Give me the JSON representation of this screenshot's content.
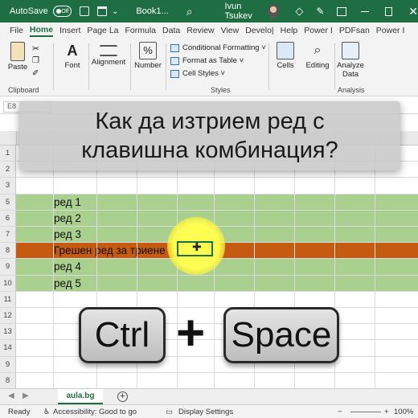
{
  "titlebar": {
    "autosave_label": "AutoSave",
    "autosave_state": "Off",
    "book_name": "Book1...",
    "user_name": "Ivun Tsukev"
  },
  "ribbon_tabs": [
    "File",
    "Home",
    "Insert",
    "Page La",
    "Formula",
    "Data",
    "Review",
    "View",
    "Develo|",
    "Help",
    "Power I",
    "PDFsan",
    "Power I"
  ],
  "ribbon": {
    "paste_label": "Paste",
    "clipboard_label": "Clipboard",
    "font_label": "Font",
    "alignment_label": "Alignment",
    "number_label": "Number",
    "conditional_formatting": "Conditional Formatting ˅",
    "format_as_table": "Format as Table ˅",
    "cell_styles": "Cell Styles ˅",
    "styles_label": "Styles",
    "cells_label": "Cells",
    "editing_label": "Editing",
    "analyze_data_line1": "Analyze",
    "analyze_data_line2": "Data",
    "analysis_label": "Analysis"
  },
  "namebox_value": "E8",
  "caption": {
    "line1": "Как да изтрием ред с",
    "line2": "клавишна комбинация?"
  },
  "rows": [
    {
      "num": "1",
      "text": "",
      "style": ""
    },
    {
      "num": "2",
      "text": "",
      "style": ""
    },
    {
      "num": "3",
      "text": "",
      "style": ""
    },
    {
      "num": "5",
      "text": "ред 1",
      "style": "green"
    },
    {
      "num": "6",
      "text": "ред 2",
      "style": "green"
    },
    {
      "num": "7",
      "text": "ред 3",
      "style": "green"
    },
    {
      "num": "8",
      "text": "Грешен ред за триене",
      "style": "orange"
    },
    {
      "num": "9",
      "text": "ред 4",
      "style": "green"
    },
    {
      "num": "10",
      "text": "ред 5",
      "style": "green"
    },
    {
      "num": "11",
      "text": "",
      "style": ""
    },
    {
      "num": "12",
      "text": "",
      "style": ""
    },
    {
      "num": "13",
      "text": "",
      "style": ""
    },
    {
      "num": "14",
      "text": "",
      "style": ""
    },
    {
      "num": "9",
      "text": "",
      "style": ""
    },
    {
      "num": "8",
      "text": "",
      "style": ""
    }
  ],
  "keys": {
    "key1": "Ctrl",
    "plus": "+",
    "key2": "Space"
  },
  "sheet_tab": "aula.bg",
  "statusbar": {
    "ready": "Ready",
    "accessibility": "Accessibility: Good to go",
    "display_settings": "Display Settings",
    "zoom": "100%"
  }
}
